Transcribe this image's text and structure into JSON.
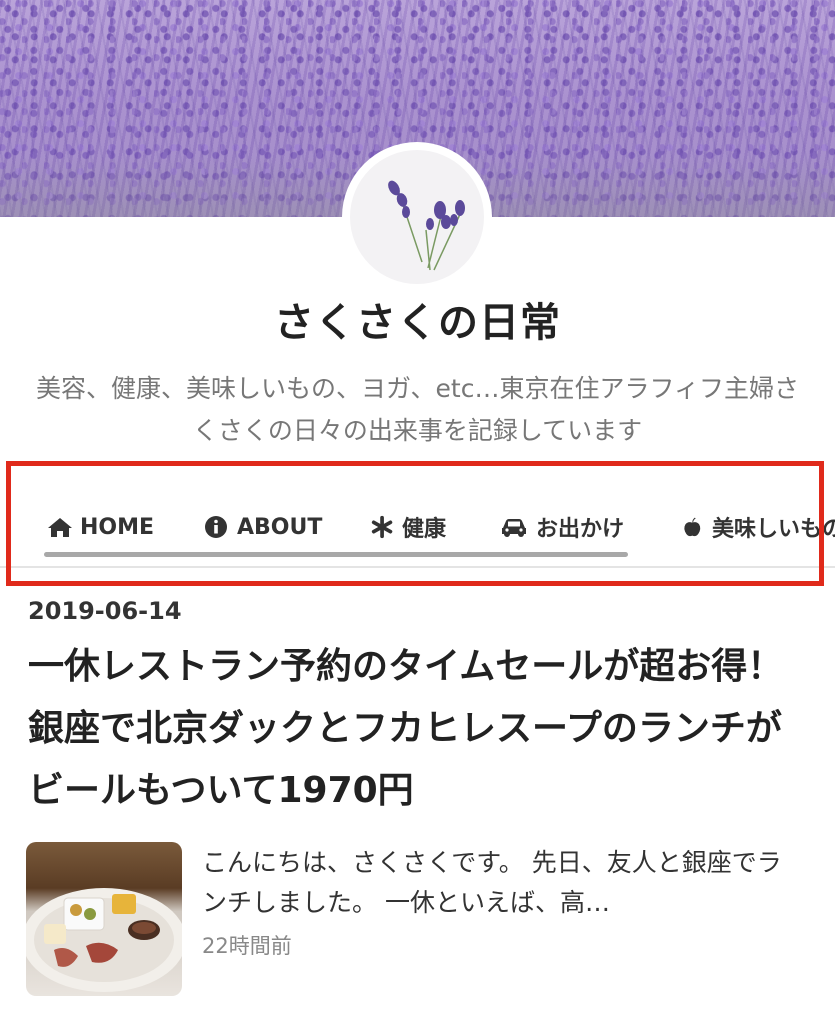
{
  "header": {
    "title": "さくさくの日常",
    "description": "美容、健康、美味しいもの、ヨガ、etc…東京在住アラフィフ主婦さくさくの日々の出来事を記録しています"
  },
  "nav": {
    "items": [
      {
        "label": "HOME",
        "icon": "home-icon"
      },
      {
        "label": "ABOUT",
        "icon": "info-icon"
      },
      {
        "label": "健康",
        "icon": "asterisk-icon"
      },
      {
        "label": "お出かけ",
        "icon": "car-icon"
      },
      {
        "label": "美味しいもの",
        "icon": "apple-icon"
      }
    ]
  },
  "article": {
    "date": "2019-06-14",
    "title": "一休レストラン予約のタイムセールが超お得！銀座で北京ダックとフカヒレスープのランチがビールもついて1970円",
    "excerpt": "こんにちは、さくさくです。 先日、友人と銀座でランチしました。 一休といえば、高…",
    "time_ago": "22時間前"
  },
  "colors": {
    "highlight": "#e02a1b",
    "banner": "#a58bcc"
  }
}
